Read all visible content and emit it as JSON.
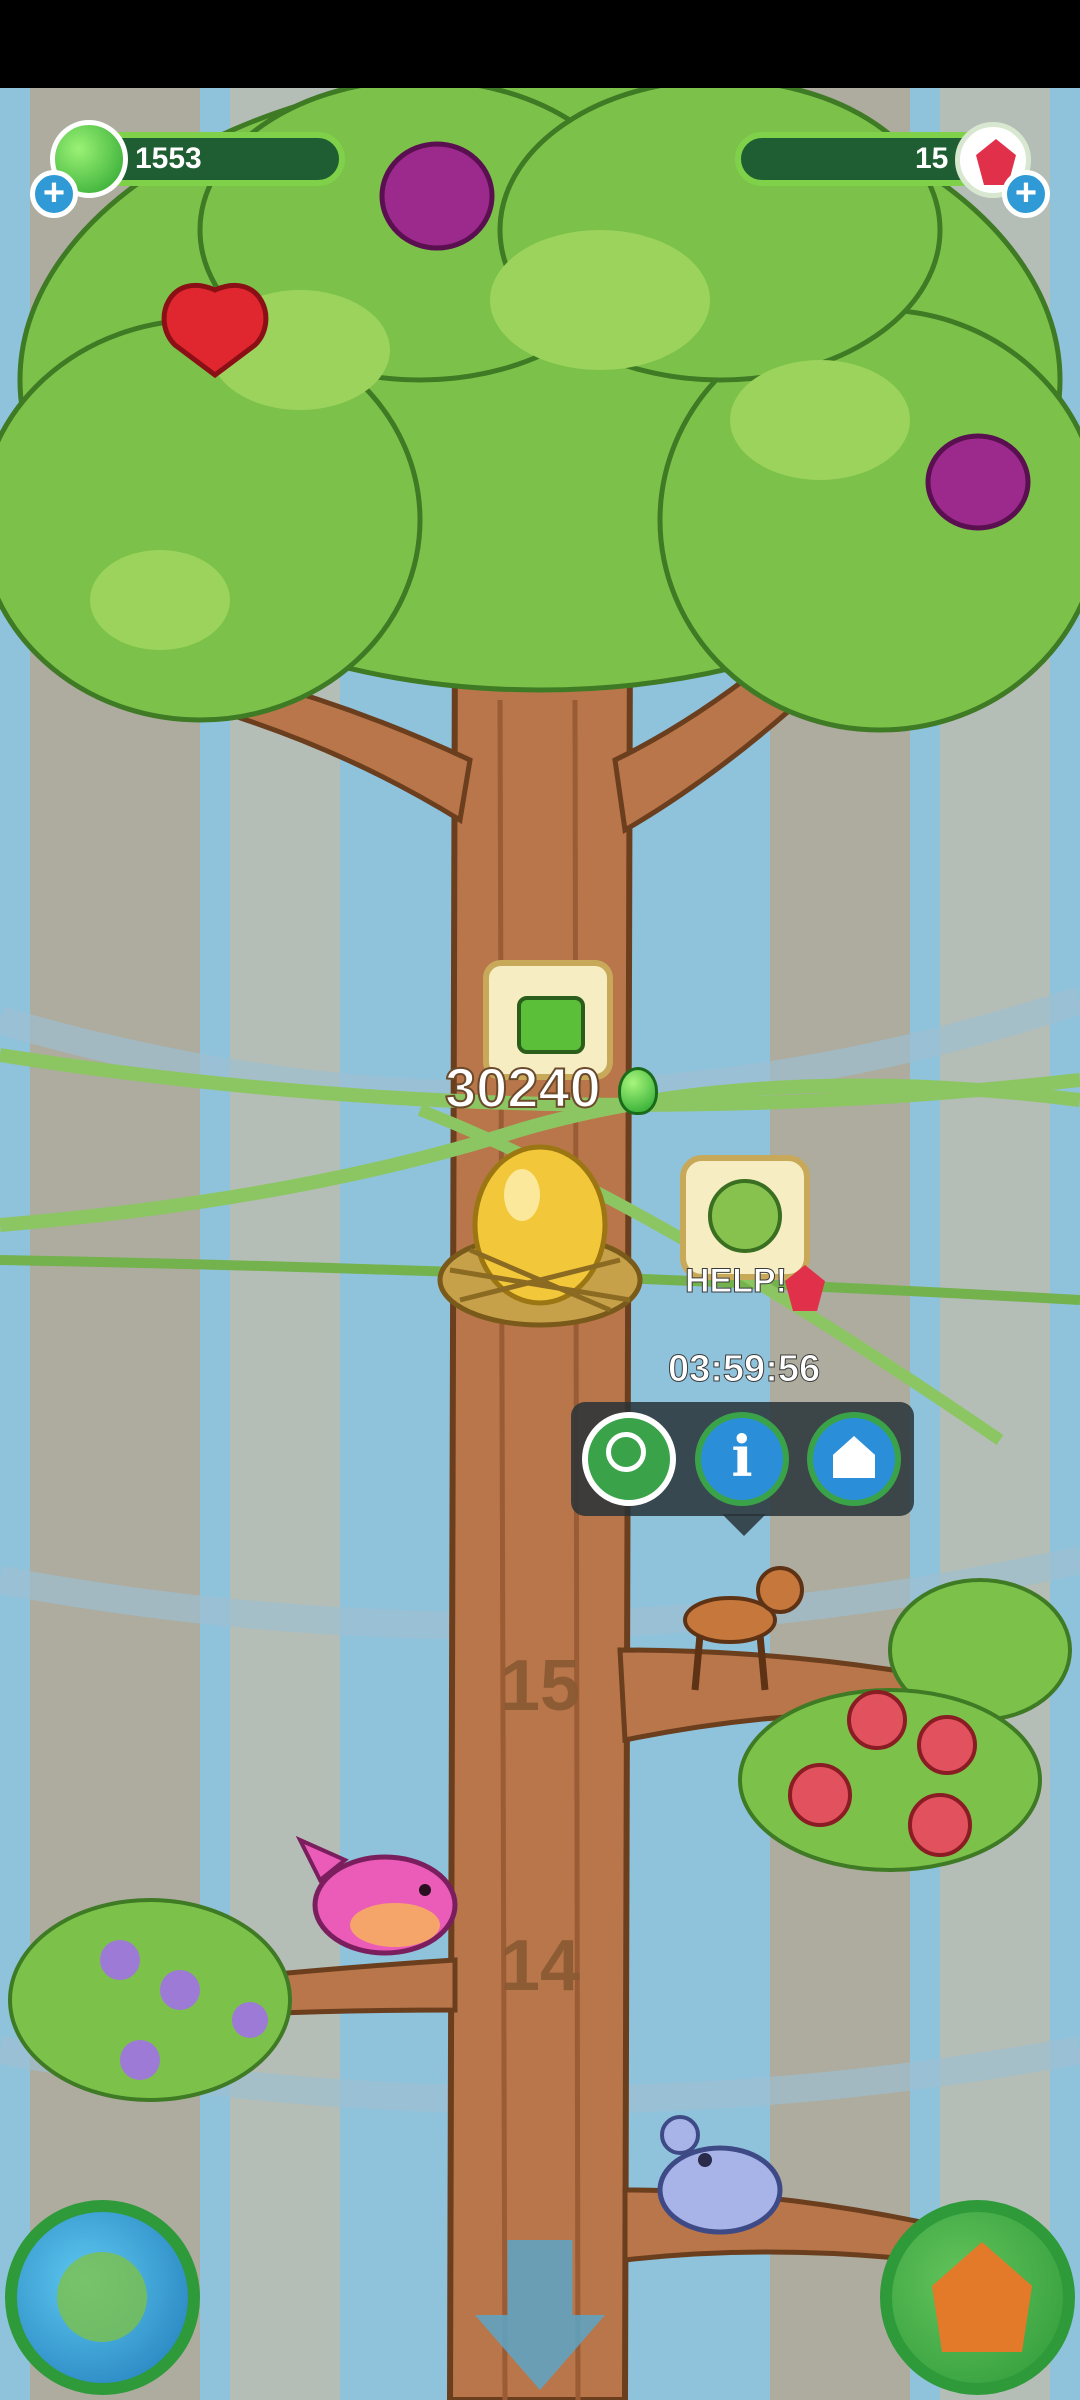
{
  "hud": {
    "jelly_count": "1553",
    "gem_count": "15"
  },
  "watering": {
    "amount": "30240"
  },
  "help_label": "HELP!",
  "timer": "03:59:56",
  "levels": [
    "15",
    "14"
  ],
  "colors": {
    "leaf": "#7cc24a",
    "trunk": "#b8764a",
    "sky": "#8fc3dc",
    "hud_dark": "#1f5e32"
  }
}
